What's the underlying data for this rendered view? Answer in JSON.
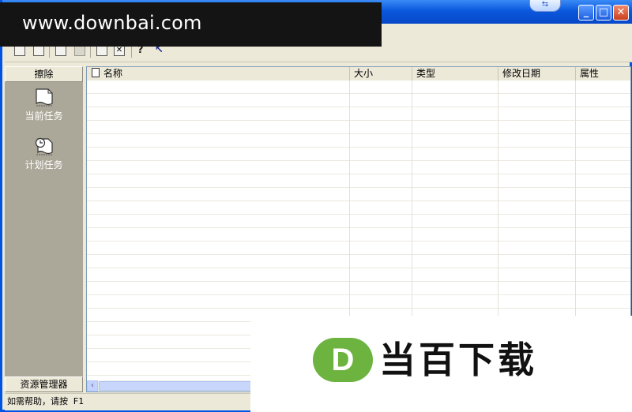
{
  "watermark": {
    "text": "www.downbai.com"
  },
  "top_badge": {
    "icon": "swap-arrow-icon"
  },
  "window_controls": {
    "minimize": "_",
    "maximize": "□",
    "close": "✕"
  },
  "toolbar": {
    "tools": [
      "new-icon",
      "open-icon",
      "copy-icon",
      "blank-icon",
      "save-icon",
      "delete-icon",
      "help-icon",
      "pointer-help-icon"
    ]
  },
  "sidebar": {
    "header": "擦除",
    "items": [
      {
        "label": "当前任务",
        "icon": "document-icon"
      },
      {
        "label": "计划任务",
        "icon": "clock-document-icon"
      }
    ],
    "footer": "资源管理器"
  },
  "list": {
    "columns": [
      "名称",
      "大小",
      "类型",
      "修改日期",
      "属性"
    ],
    "rows": []
  },
  "status": {
    "text": "如需帮助，请按 F1"
  },
  "brand": {
    "logo_letter": "D",
    "text": "当百下载",
    "logo_color": "#6db33f"
  }
}
